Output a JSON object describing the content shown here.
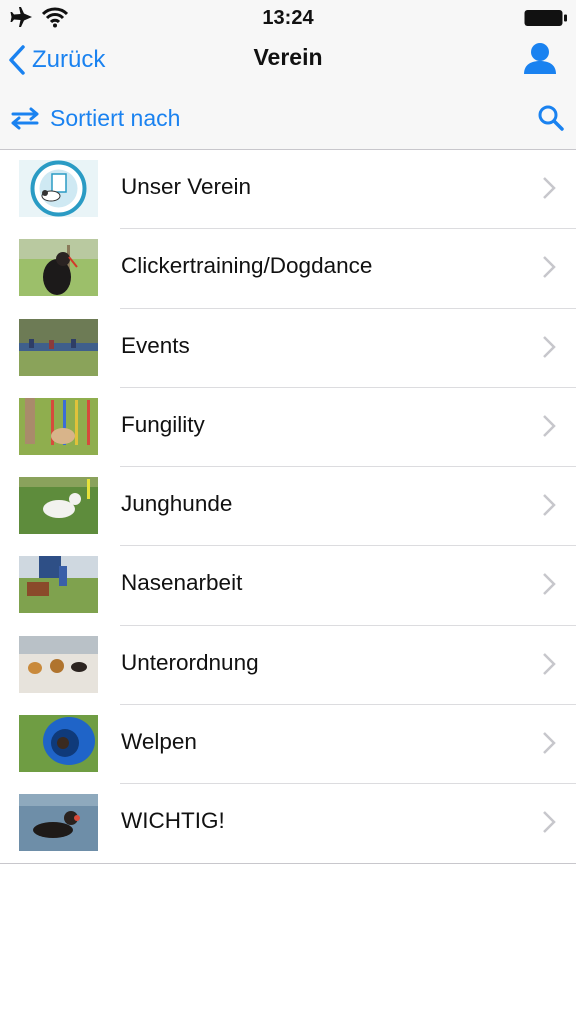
{
  "status_bar": {
    "time": "13:24",
    "airplane_icon": "airplane-icon",
    "wifi_icon": "wifi-icon",
    "battery_icon": "battery-icon"
  },
  "nav": {
    "back_label": "Zurück",
    "title": "Verein",
    "profile_icon": "person-icon"
  },
  "toolbar": {
    "sort_label": "Sortiert nach",
    "search_icon": "search-icon"
  },
  "items": [
    {
      "label": "Unser Verein"
    },
    {
      "label": "Clickertraining/Dogdance"
    },
    {
      "label": "Events"
    },
    {
      "label": "Fungility"
    },
    {
      "label": "Junghunde"
    },
    {
      "label": "Nasenarbeit"
    },
    {
      "label": "Unterordnung"
    },
    {
      "label": "Welpen"
    },
    {
      "label": "WICHTIG!"
    }
  ],
  "colors": {
    "accent": "#1a82f0",
    "bar_background": "#f7f7f7",
    "separator": "#c8c7cc",
    "chevron": "#c7c7cc"
  }
}
